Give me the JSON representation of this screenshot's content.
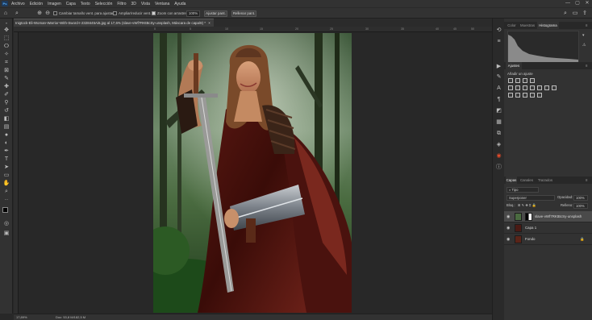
{
  "app": {
    "logo": "Ps"
  },
  "menu": [
    "Archivo",
    "Edición",
    "Imagen",
    "Capa",
    "Texto",
    "Selección",
    "Filtro",
    "3D",
    "Vista",
    "Ventana",
    "Ayuda"
  ],
  "window_controls": {
    "minimize": "—",
    "maximize": "▢",
    "close": "✕"
  },
  "options": {
    "resize_to_fit": "Cambiar tamaño vent. para ajustar",
    "zoom_all": "Ampliar/reducir vent.",
    "scrubby_zoom": "Zoom con arrastre",
    "zoom_value": "100%",
    "fit_screen": "Ajustar pant.",
    "fill_screen": "Rellenar pant."
  },
  "document": {
    "tab_title": "Inigtock-Eli-Woman-Warrior-With-Sword-I-2328445Ai6.jpg al 17,6% (slave-vWf7RKtBcSy-unsplash, Máscara de capa/8) *",
    "tab_close": "×",
    "ruler_top": [
      "0",
      "5",
      "10",
      "15",
      "20",
      "25",
      "30",
      "35",
      "40",
      "45",
      "50"
    ],
    "zoom": "17,89%",
    "doc_info": "Doc: 53,8 M/182,5 M"
  },
  "panels": {
    "top_tabs": [
      "Color",
      "Muestras",
      "Histograma"
    ],
    "active_top_tab": "Histograma",
    "adjustments": {
      "tab": "Ajustes",
      "subtitle": "Añadir un ajuste"
    },
    "layers": {
      "tabs": [
        "Capas",
        "Canales",
        "Trazados"
      ],
      "active_tab": "Capas",
      "filter": "Tipo",
      "blend_mode": "Superponer",
      "opacity_label": "Opacidad:",
      "opacity_value": "100%",
      "lock_label": "Bloq.:",
      "fill_label": "Relleno:",
      "fill_value": "100%",
      "items": [
        {
          "name": "slave-vWf7RKtBcSy-unsplash",
          "selected": true
        },
        {
          "name": "Capa 1",
          "selected": false
        },
        {
          "name": "Fondo",
          "selected": false
        }
      ]
    }
  },
  "colors": {
    "accent": "#5ab4ff",
    "panel_bg": "#323232",
    "canvas_bg": "#282828"
  }
}
